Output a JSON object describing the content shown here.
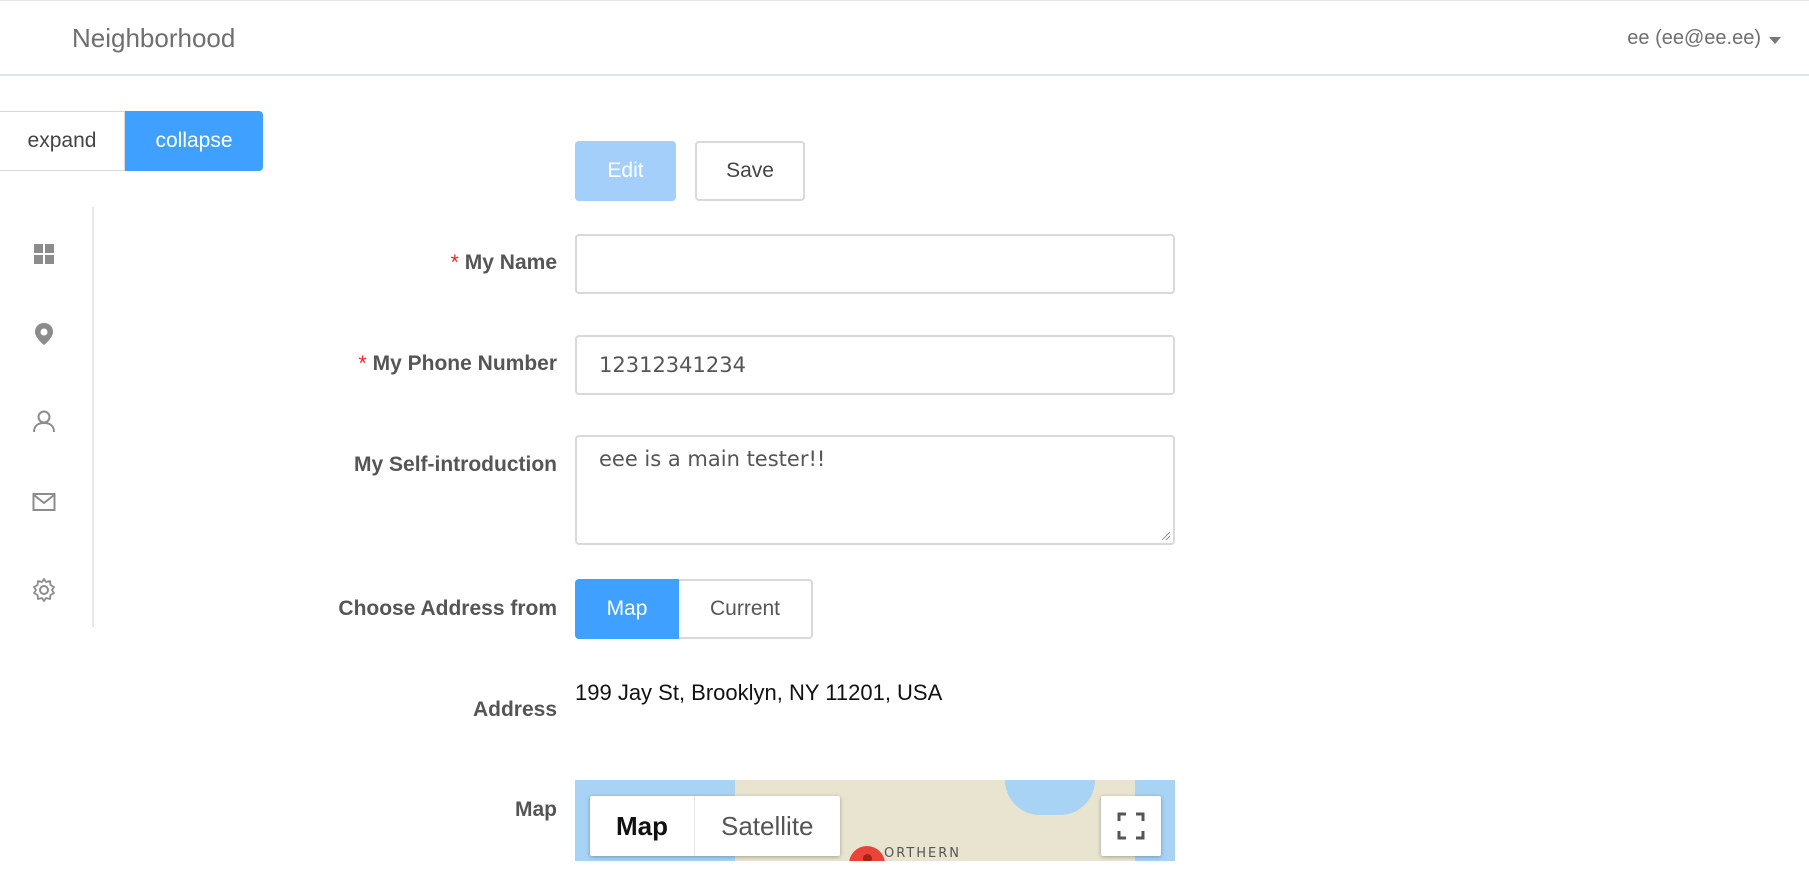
{
  "header": {
    "brand": "Neighborhood",
    "user_label": "ee (ee@ee.ee)"
  },
  "sidebar": {
    "expand_label": "expand",
    "collapse_label": "collapse",
    "items": [
      {
        "icon": "dashboard-icon"
      },
      {
        "icon": "location-pin-icon"
      },
      {
        "icon": "user-icon"
      },
      {
        "icon": "mail-icon"
      },
      {
        "icon": "gear-icon"
      }
    ]
  },
  "toolbar": {
    "edit_label": "Edit",
    "save_label": "Save"
  },
  "form": {
    "required_mark": "*",
    "name_label": "My Name",
    "name_value": "",
    "phone_label": "My Phone Number",
    "phone_value": "12312341234",
    "intro_label": "My Self-introduction",
    "intro_value": "eee is a main tester!!",
    "address_source_label": "Choose Address from",
    "address_source_options": [
      "Map",
      "Current"
    ],
    "address_source_selected": "Map",
    "address_label": "Address",
    "address_value": "199 Jay St, Brooklyn, NY 11201, USA",
    "map_label": "Map"
  },
  "map": {
    "type_options": [
      "Map",
      "Satellite"
    ],
    "selected_type": "Map",
    "visible_place_label": "ORTHERN"
  },
  "colors": {
    "primary": "#40a0ff",
    "primary_disabled": "#a4cffb",
    "required": "#f5222d"
  }
}
